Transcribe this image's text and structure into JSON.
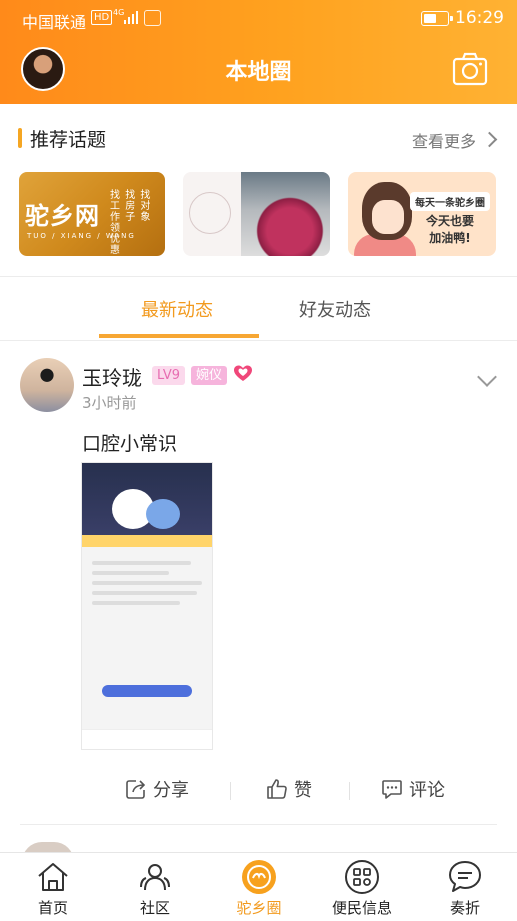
{
  "status_bar": {
    "carrier": "中国联通",
    "hd": "HD",
    "network": "4G",
    "time": "16:29"
  },
  "header": {
    "title": "本地圈"
  },
  "topics": {
    "title": "推荐话题",
    "see_more": "查看更多",
    "cards": [
      {
        "title": "驼乡网",
        "cols": [
          "找工作",
          "找房子",
          "找对象",
          "领优惠"
        ],
        "sub": "TUO / XIANG / WANG"
      },
      {
        "title": ""
      },
      {
        "line1": "每天一条驼乡圈",
        "line2": "今天也要",
        "line3": "加油鸭!"
      }
    ]
  },
  "tabs": [
    {
      "label": "最新动态",
      "active": true
    },
    {
      "label": "好友动态",
      "active": false
    }
  ],
  "post": {
    "user": "玉玲珑",
    "level": "LV9",
    "tag": "婉仪",
    "time": "3小时前",
    "text": "口腔小常识",
    "actions": {
      "share": "分享",
      "like": "赞",
      "comment": "评论"
    }
  },
  "bottom_nav": [
    {
      "label": "首页",
      "icon": "home-icon"
    },
    {
      "label": "社区",
      "icon": "community-icon"
    },
    {
      "label": "驼乡圈",
      "icon": "camel-circle-icon",
      "active": true
    },
    {
      "label": "便民信息",
      "icon": "grid-icon"
    },
    {
      "label": "奏折",
      "icon": "chat-icon"
    }
  ],
  "colors": {
    "accent": "#f29a1e",
    "header_start": "#ff8a1a",
    "header_end": "#ffb233",
    "badge_pink": "#e76cb1"
  }
}
